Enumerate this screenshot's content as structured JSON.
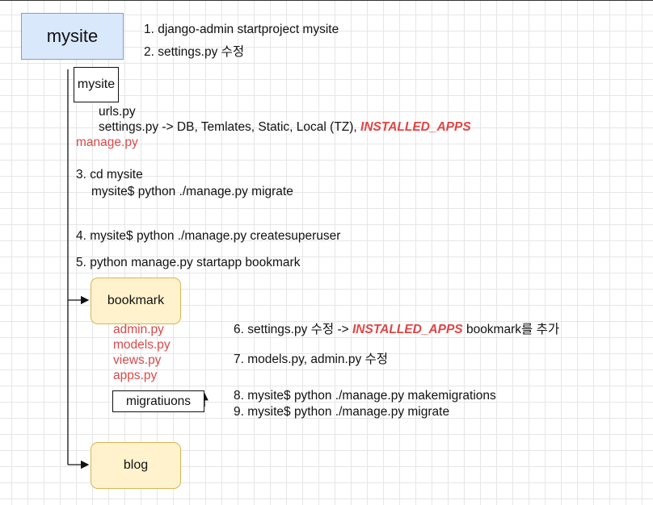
{
  "root": {
    "label": "mysite"
  },
  "steps": {
    "s1": "1. django-admin startproject mysite",
    "s2": "2. settings.py 수정",
    "s3a": "3. cd mysite",
    "s3b": "mysite$   python ./manage.py  migrate",
    "s4": "4. mysite$   python ./manage.py  createsuperuser",
    "s5": "5. python manage.py startapp bookmark",
    "s6_pre": "6. settings.py 수정 -> ",
    "s6_hl": "INSTALLED_APPS",
    "s6_post": " bookmark를 추가",
    "s7": "7. models.py, admin.py 수정",
    "s8": "8.  mysite$   python ./manage.py  makemigrations",
    "s9": "9.  mysite$   python ./manage.py  migrate"
  },
  "project": {
    "package_label": "mysite",
    "urls": "urls.py",
    "settings_pre": "settings.py -> DB, Temlates, Static, Local (TZ), ",
    "settings_hl": "INSTALLED_APPS",
    "manage": "manage.py"
  },
  "bookmark": {
    "label": "bookmark",
    "files": [
      "admin.py",
      "models.py",
      "views.py",
      "apps.py"
    ],
    "migrations_label": "migratiuons"
  },
  "blog": {
    "label": "blog"
  }
}
